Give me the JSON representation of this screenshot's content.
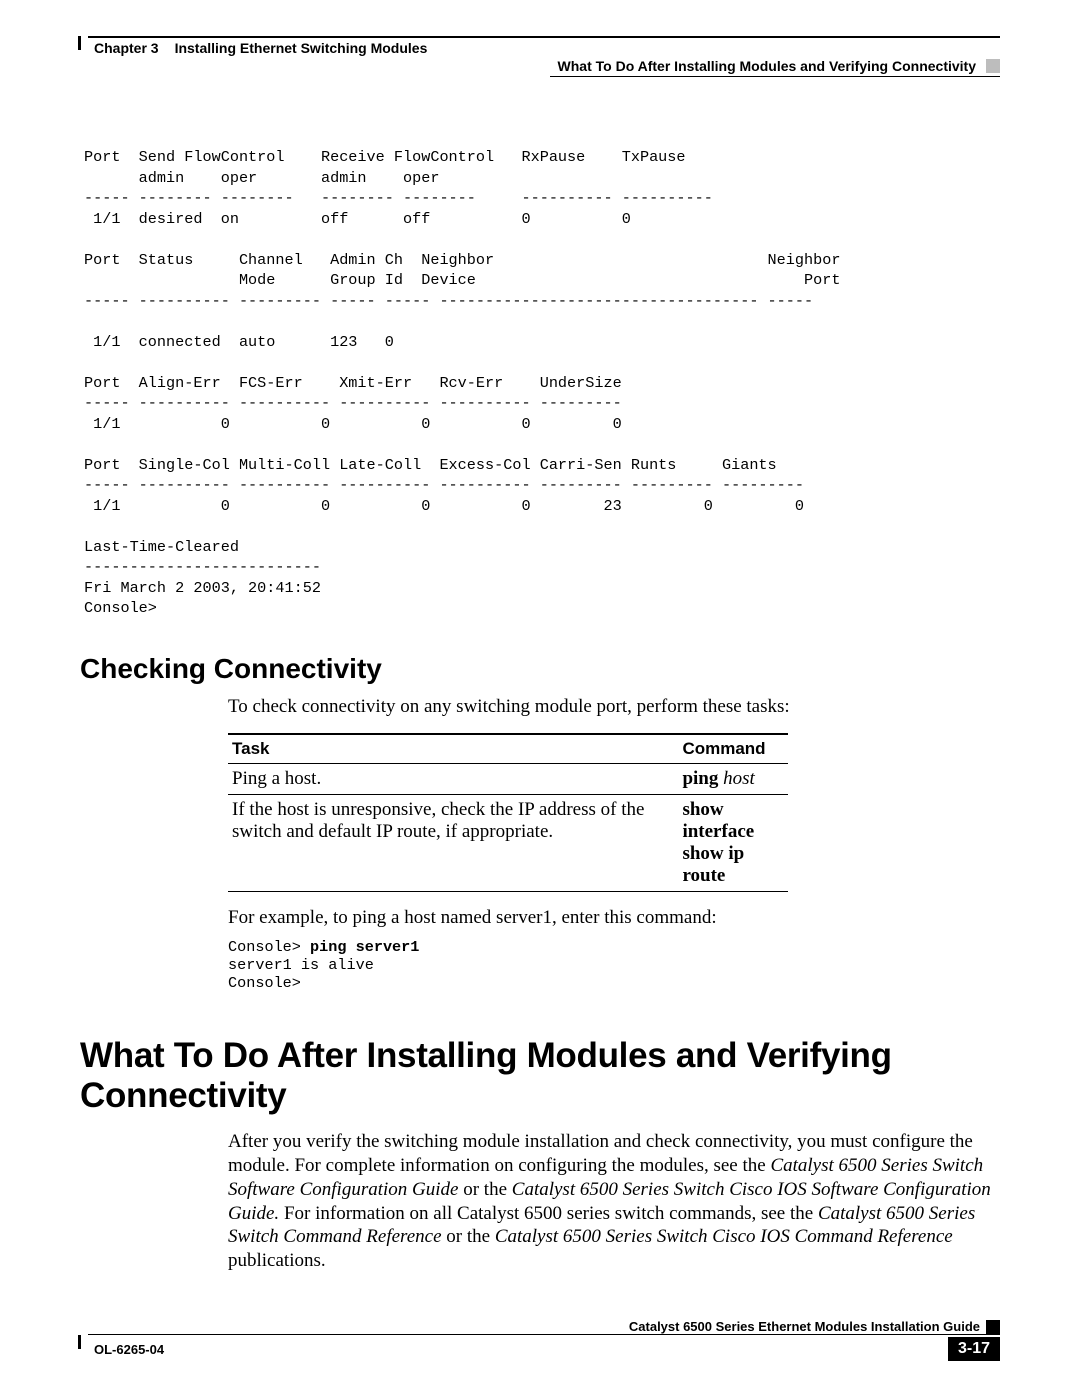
{
  "header": {
    "chapter_label": "Chapter 3",
    "chapter_title": "Installing Ethernet Switching Modules",
    "section_title": "What To Do After Installing Modules and Verifying Connectivity"
  },
  "cli_block": "Port  Send FlowControl    Receive FlowControl   RxPause    TxPause\n      admin    oper       admin    oper\n----- -------- --------   -------- --------     ---------- ----------\n 1/1  desired  on         off      off          0          0\n\nPort  Status     Channel   Admin Ch  Neighbor                              Neighbor\n                 Mode      Group Id  Device                                    Port\n----- ---------- --------- ----- ----- ----------------------------------- -----\n\n 1/1  connected  auto      123   0\n\nPort  Align-Err  FCS-Err    Xmit-Err   Rcv-Err    UnderSize\n----- ---------- ---------- ---------- ---------- ---------\n 1/1           0          0          0          0         0\n\nPort  Single-Col Multi-Coll Late-Coll  Excess-Col Carri-Sen Runts     Giants\n----- ---------- ---------- ---------- ---------- --------- --------- ---------\n 1/1           0          0          0          0        23         0         0\n\nLast-Time-Cleared\n--------------------------\nFri March 2 2003, 20:41:52\nConsole>",
  "section1": {
    "heading": "Checking Connectivity",
    "intro": "To check connectivity on any switching module port, perform these tasks:",
    "table": {
      "h1": "Task",
      "h2": "Command",
      "r1_task": "Ping a host.",
      "r1_cmd_bold": "ping",
      "r1_cmd_ital": "host",
      "r2_task": "If the host is unresponsive, check the IP address of the switch and default IP route, if appropriate.",
      "r2_cmd_l1": "show interface",
      "r2_cmd_l2": "show ip route"
    },
    "example_intro": "For example, to ping a host named server1, enter this command:",
    "ping_prefix": "Console> ",
    "ping_cmd": "ping server1",
    "ping_out": "server1 is alive\nConsole>"
  },
  "section2": {
    "heading": "What To Do After Installing Modules and Verifying Connectivity",
    "para_pre": "After you verify the switching module installation and check connectivity, you must configure the module. For complete information on configuring the modules, see the ",
    "ref1": "Catalyst 6500 Series Switch Software Configuration Guide",
    "mid1": " or the ",
    "ref2": "Catalyst 6500 Series Switch Cisco IOS Software Configuration Guide.",
    "mid2": " For information on all Catalyst 6500 series switch commands, see the ",
    "ref3": "Catalyst 6500 Series Switch Command Reference",
    "mid3": " or the ",
    "ref4": "Catalyst 6500 Series Switch Cisco IOS Command Reference",
    "post": " publications."
  },
  "footer": {
    "guide": "Catalyst 6500 Series Ethernet Modules Installation Guide",
    "docnum": "OL-6265-04",
    "page": "3-17"
  }
}
